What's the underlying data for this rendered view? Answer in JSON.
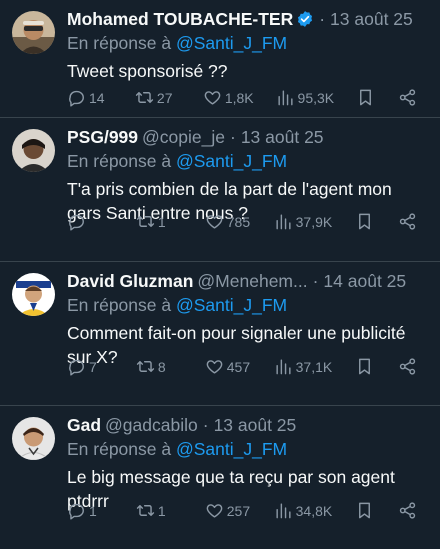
{
  "reply_prefix": "En réponse à",
  "tweets": [
    {
      "name": "Mohamed TOUBACHE-TER",
      "handle": "",
      "verified": true,
      "date": "13 août 25",
      "reply_to": "@Santi_J_FM",
      "text": "Tweet sponsorisé ??",
      "replies": "14",
      "retweets": "27",
      "likes": "1,8K",
      "views": "95,3K"
    },
    {
      "name": "PSG/999",
      "handle": "@copie_je",
      "verified": false,
      "date": "13 août 25",
      "reply_to": "@Santi_J_FM",
      "text": "T'a pris combien de la part de l'agent mon gars Santi entre nous ?",
      "replies": "",
      "retweets": "1",
      "likes": "785",
      "views": "37,9K"
    },
    {
      "name": "David Gluzman",
      "handle": "@Menehem...",
      "verified": false,
      "date": "14 août 25",
      "reply_to": "@Santi_J_FM",
      "text": "Comment fait-on pour signaler une publicité sur X?",
      "replies": "7",
      "retweets": "8",
      "likes": "457",
      "views": "37,1K"
    },
    {
      "name": "Gad",
      "handle": "@gadcabilo",
      "verified": false,
      "date": "13 août 25",
      "reply_to": "@Santi_J_FM",
      "text": "Le big message que ta reçu par son agent ptdrrr",
      "replies": "1",
      "retweets": "1",
      "likes": "257",
      "views": "34,8K"
    }
  ],
  "icons": {
    "reply": "reply-icon",
    "retweet": "retweet-icon",
    "like": "heart-icon",
    "views": "views-icon",
    "bookmark": "bookmark-icon",
    "share": "share-icon",
    "verified": "verified-badge-icon"
  },
  "colors": {
    "background": "#15202b",
    "text": "#f7f9f9",
    "secondary": "#8b98a5",
    "link": "#1d9bf0",
    "divider": "#38444d"
  }
}
